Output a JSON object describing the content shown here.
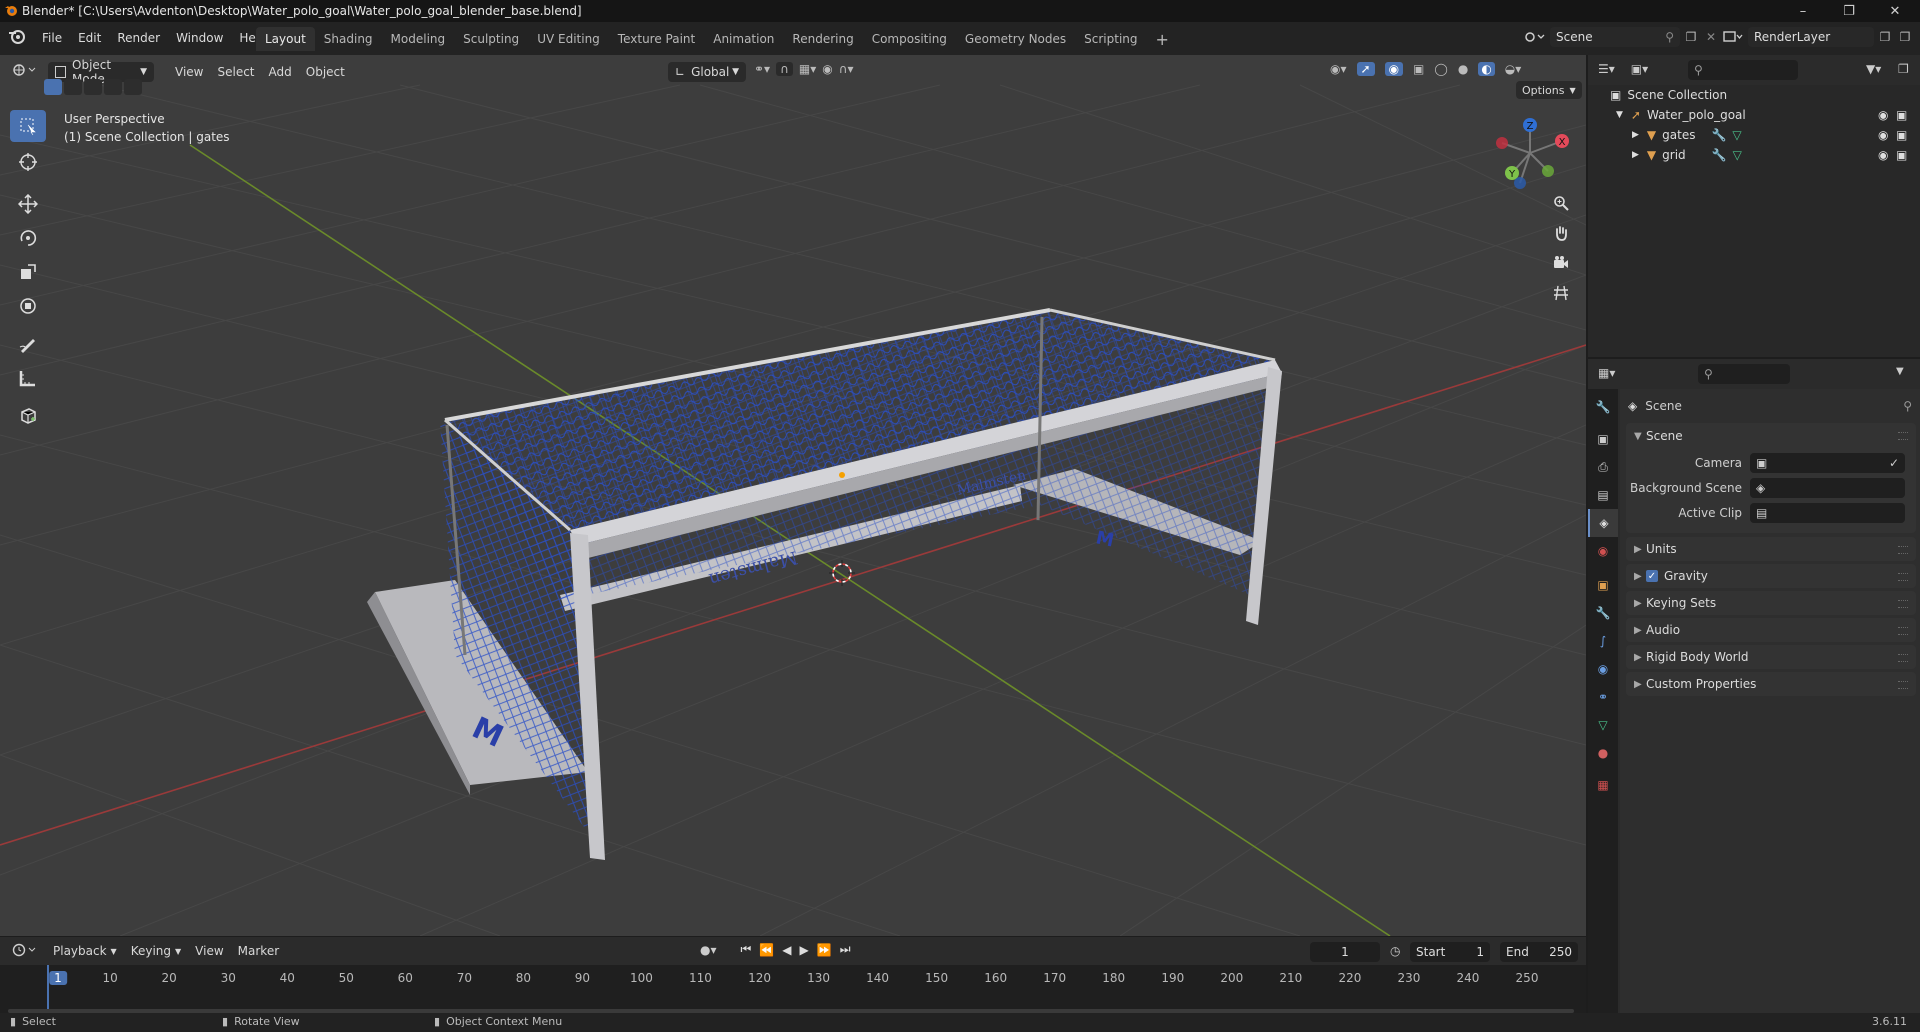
{
  "window": {
    "title": "Blender* [C:\\Users\\Avdenton\\Desktop\\Water_polo_goal\\Water_polo_goal_blender_base.blend]"
  },
  "menu": [
    "File",
    "Edit",
    "Render",
    "Window",
    "Help"
  ],
  "workspaces": [
    "Layout",
    "Shading",
    "Modeling",
    "Sculpting",
    "UV Editing",
    "Texture Paint",
    "Animation",
    "Rendering",
    "Compositing",
    "Geometry Nodes",
    "Scripting"
  ],
  "active_workspace": "Layout",
  "scene_selector": {
    "value": "Scene"
  },
  "view_layer": {
    "value": "RenderLayer"
  },
  "viewport": {
    "mode": "Object Mode",
    "menus": [
      "View",
      "Select",
      "Add",
      "Object"
    ],
    "transform_orientation": "Global",
    "options_label": "Options",
    "overlay_line1": "User Perspective",
    "overlay_line2": "(1) Scene Collection | gates",
    "gizmo_axes": {
      "x": "X",
      "y": "Y",
      "z": "Z"
    },
    "net_brand": "Malmsten",
    "colors": {
      "background": "#3d3d3d",
      "grid": "#474747",
      "x_axis": "#9a3a3a",
      "y_axis": "#6a8a2a",
      "frame": "#c9c9c9",
      "net": "#2a4fc8"
    }
  },
  "toolbar_tools": [
    "select-box",
    "cursor",
    "move",
    "rotate",
    "scale",
    "transform",
    "annotate",
    "measure",
    "add-cube"
  ],
  "timeline": {
    "menus": [
      "Playback",
      "Keying",
      "View",
      "Marker"
    ],
    "current_frame": "1",
    "start_label": "Start",
    "start": "1",
    "end_label": "End",
    "end": "250",
    "ticks": [
      "1",
      "10",
      "20",
      "30",
      "40",
      "50",
      "60",
      "70",
      "80",
      "90",
      "100",
      "110",
      "120",
      "130",
      "140",
      "150",
      "160",
      "170",
      "180",
      "190",
      "200",
      "210",
      "220",
      "230",
      "240",
      "250"
    ]
  },
  "statusbar": {
    "items": [
      "Select",
      "Rotate View",
      "Object Context Menu"
    ],
    "version": "3.6.11"
  },
  "outliner": {
    "root": "Scene Collection",
    "items": [
      {
        "name": "Water_polo_goal"
      },
      {
        "name": "gates"
      },
      {
        "name": "grid"
      }
    ]
  },
  "properties": {
    "context_title": "Scene",
    "section_title": "Scene",
    "rows": [
      {
        "label": "Camera"
      },
      {
        "label": "Background Scene"
      },
      {
        "label": "Active Clip"
      }
    ],
    "panels": [
      "Units",
      "Gravity",
      "Keying Sets",
      "Audio",
      "Rigid Body World",
      "Custom Properties"
    ],
    "gravity_checked": true
  }
}
